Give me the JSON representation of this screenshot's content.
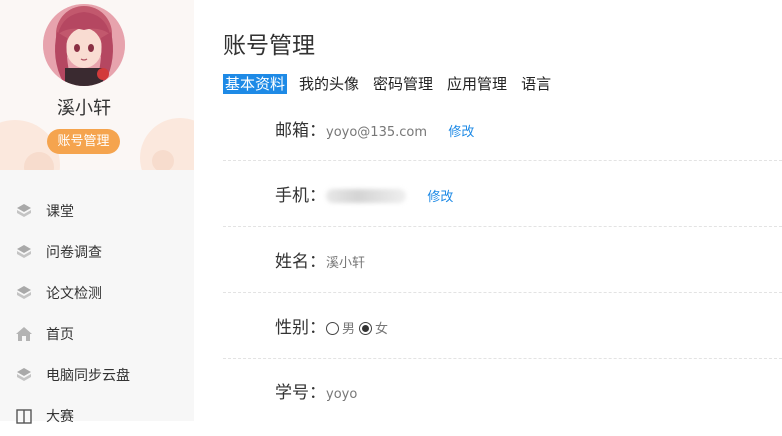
{
  "sidebar": {
    "username": "溪小轩",
    "badge": "账号管理",
    "items": [
      {
        "label": "课堂",
        "icon": "cube-icon"
      },
      {
        "label": "问卷调查",
        "icon": "cube-icon"
      },
      {
        "label": "论文检测",
        "icon": "cube-icon"
      },
      {
        "label": "首页",
        "icon": "home-icon"
      },
      {
        "label": "电脑同步云盘",
        "icon": "cube-icon"
      },
      {
        "label": "大赛",
        "icon": "book-icon"
      }
    ]
  },
  "main": {
    "title": "账号管理",
    "tabs": [
      {
        "label": "基本资料",
        "active": true
      },
      {
        "label": "我的头像",
        "active": false
      },
      {
        "label": "密码管理",
        "active": false
      },
      {
        "label": "应用管理",
        "active": false
      },
      {
        "label": "语言",
        "active": false
      }
    ],
    "fields": {
      "email": {
        "label": "邮箱：",
        "value": "yoyo@135.com",
        "action": "修改"
      },
      "phone": {
        "label": "手机：",
        "action": "修改"
      },
      "name": {
        "label": "姓名：",
        "value": "溪小轩"
      },
      "gender": {
        "label": "性别：",
        "options": [
          "男",
          "女"
        ],
        "selected": "女"
      },
      "student_id": {
        "label": "学号：",
        "value": "yoyo"
      }
    }
  },
  "colors": {
    "accent": "#1e8ae6",
    "badge": "#f5a44e"
  }
}
